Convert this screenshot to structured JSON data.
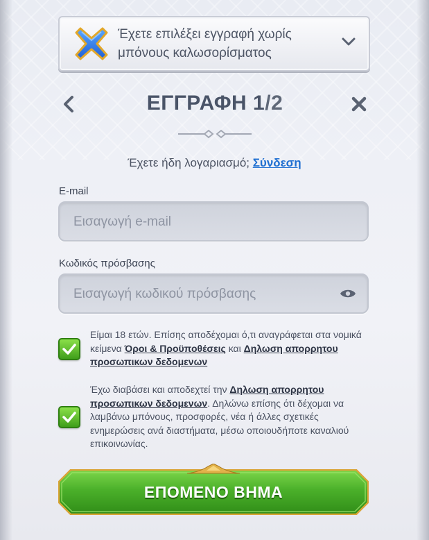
{
  "bonus_banner": {
    "text": "Έχετε επιλέξει εγγραφή χωρίς μπόνους καλωσορίσματος",
    "icon": "x-icon",
    "chevron": "chevron-down-icon"
  },
  "header": {
    "title": "ΕΓΓΡΑΦΗ 1",
    "step_suffix": "/2",
    "back_icon": "chevron-left-icon",
    "close_icon": "close-icon"
  },
  "login_prompt": {
    "text": "Έχετε ήδη λογαριασμό; ",
    "link": "Σύνδεση"
  },
  "email": {
    "label": "E-mail",
    "placeholder": "Εισαγωγή e-mail",
    "value": ""
  },
  "password": {
    "label": "Κωδικός πρόσβασης",
    "placeholder": "Εισαγωγή κωδικού πρόσβασης",
    "value": "",
    "toggle_icon": "eye-icon"
  },
  "consent_terms": {
    "checked": true,
    "text_1": "Είμαι 18 ετών. Επίσης αποδέχομαι ό,τι αναγράφεται στα νομικά κείμενα ",
    "link_1": "Όροι & Προϋποθέσεις",
    "text_2": " και ",
    "link_2": "Δηλωση απορρητου προσωπικων δεδομενων"
  },
  "consent_marketing": {
    "checked": true,
    "text_1": "Έχω διαβάσει και αποδεχτεί την ",
    "link_1": "Δηλωση απορρητου προσωπικων δεδομενων",
    "text_2": ". Δηλώνω επίσης ότι δέχομαι να λαμβάνω μπόνους, προσφορές, νέα ή άλλες σχετικές ενημερώσεις ανά διαστήματα, μέσω οποιουδήποτε καναλιού επικοινωνίας."
  },
  "next_button": {
    "label": "ΕΠΟΜΕΝΟ ΒΗΜΑ"
  },
  "colors": {
    "accent_link": "#1f6fd1",
    "button_green": "#4bb02a",
    "checkbox_green": "#5cbf2a",
    "title_text": "#4a5468"
  }
}
